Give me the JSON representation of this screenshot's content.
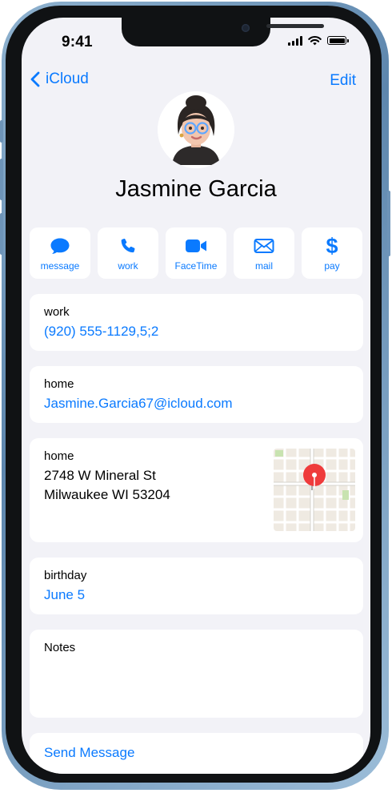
{
  "status_bar": {
    "time": "9:41"
  },
  "nav": {
    "back_label": "iCloud",
    "edit_label": "Edit"
  },
  "contact": {
    "name": "Jasmine Garcia"
  },
  "actions": [
    {
      "label": "message",
      "icon": "message-bubble-icon"
    },
    {
      "label": "work",
      "icon": "phone-icon"
    },
    {
      "label": "FaceTime",
      "icon": "video-camera-icon"
    },
    {
      "label": "mail",
      "icon": "envelope-icon"
    },
    {
      "label": "pay",
      "icon": "dollar-icon"
    }
  ],
  "phone": {
    "label": "work",
    "value": "(920) 555-1129,5;2"
  },
  "email": {
    "label": "home",
    "value": "Jasmine.Garcia67@icloud.com"
  },
  "address": {
    "label": "home",
    "line1": "2748 W Mineral St",
    "line2": "Milwaukee WI 53204"
  },
  "birthday": {
    "label": "birthday",
    "value": "June 5"
  },
  "notes": {
    "label": "Notes",
    "value": ""
  },
  "footer": {
    "send_message_label": "Send Message"
  },
  "colors": {
    "accent": "#0a7aff",
    "background": "#f2f2f7",
    "card": "#ffffff",
    "map_pin": "#ef3b3b"
  }
}
